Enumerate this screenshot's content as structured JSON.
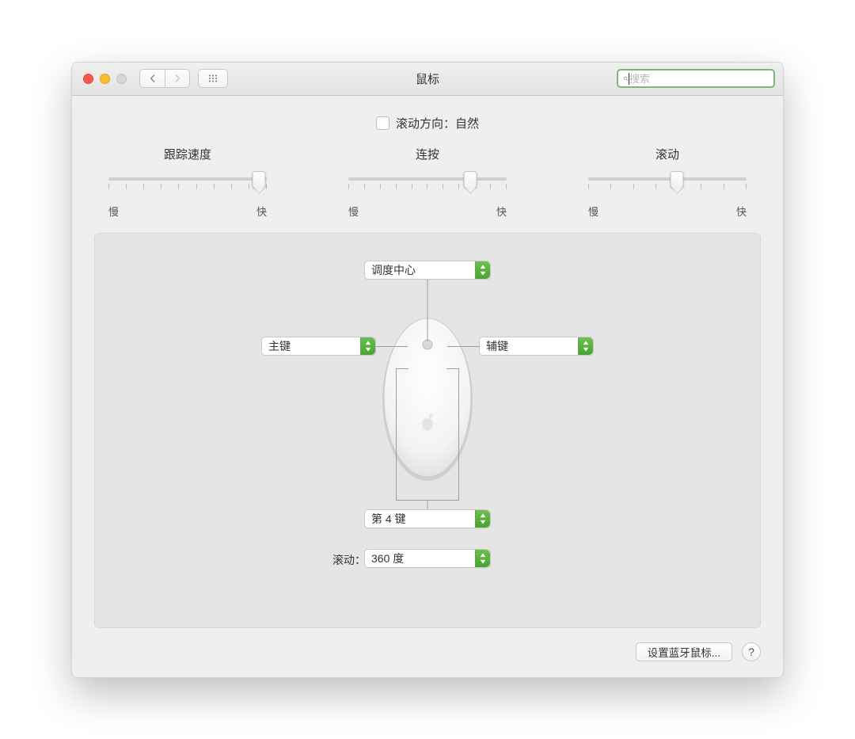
{
  "window": {
    "title": "鼠标"
  },
  "search": {
    "placeholder": "搜索"
  },
  "scroll_direction": {
    "label": "滚动方向：自然",
    "checked": false
  },
  "sliders": {
    "tracking": {
      "title": "跟踪速度",
      "slow": "慢",
      "fast": "快",
      "value_pct": 95,
      "ticks": 10
    },
    "double_click": {
      "title": "连按",
      "slow": "慢",
      "fast": "快",
      "value_pct": 77,
      "ticks": 11
    },
    "scrolling": {
      "title": "滚动",
      "slow": "慢",
      "fast": "快",
      "value_pct": 56,
      "ticks": 8
    }
  },
  "mouse": {
    "top": "调度中心",
    "left": "主键",
    "right": "辅键",
    "bottom": "第 4 键",
    "scroll_label": "滚动：",
    "scroll_value": "360 度"
  },
  "footer": {
    "bluetooth": "设置蓝牙鼠标...",
    "help": "?"
  }
}
